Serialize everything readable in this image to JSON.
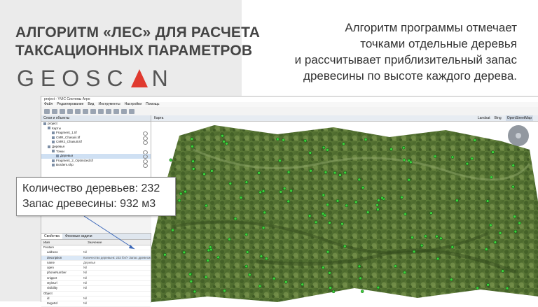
{
  "slide": {
    "title_line1": "АЛГОРИТМ «ЛЕС» ДЛЯ РАСЧЕТА",
    "title_line2": "ТАКСАЦИОННЫХ ПАРАМЕТРОВ",
    "brand_part1": "GEOSC",
    "brand_part2": "N",
    "description": [
      "Алгоритм программы отмечает",
      "точками отдельные деревья",
      "и рассчитывает приблизительный запас",
      "древесины по высоте каждого дерева."
    ],
    "accent_color": "#e03a2f"
  },
  "app": {
    "window_title": "project - YVIC Системы Агро",
    "menu": [
      "Файл",
      "Редактирование",
      "Вид",
      "Инструменты",
      "Настройки",
      "Помощь"
    ],
    "layers_tab": "Слои и объекты",
    "tree": [
      {
        "label": "project",
        "indent": 0
      },
      {
        "label": "Карты",
        "indent": 1
      },
      {
        "label": "Fragment_1.tif",
        "indent": 2
      },
      {
        "label": "CMR_Chasuiii.tif",
        "indent": 2
      },
      {
        "label": "CMR2_Chasuiii.tif",
        "indent": 2
      },
      {
        "label": "Деревья",
        "indent": 1
      },
      {
        "label": "Точки",
        "indent": 2
      },
      {
        "label": "Деревья",
        "indent": 3
      },
      {
        "label": "Fragment_2_Optimized.tif",
        "indent": 2
      },
      {
        "label": "Borders.shp",
        "indent": 2
      }
    ],
    "properties_tab": "Свойства",
    "tasks_tab": "Фоновые задачи",
    "props_header": {
      "name": "Имя",
      "value": "Значение"
    },
    "props": [
      {
        "key": "Feature",
        "value": "",
        "group": true
      },
      {
        "key": "address",
        "value": "Nil"
      },
      {
        "key": "description",
        "value": "Количество деревьев: 232 /br/> Запас древесины: 932.17 м³/br/>",
        "selected": true
      },
      {
        "key": "name",
        "value": "Деревья"
      },
      {
        "key": "open",
        "value": "Nil"
      },
      {
        "key": "phoneNumber",
        "value": "Nil"
      },
      {
        "key": "snippet",
        "value": "Nil"
      },
      {
        "key": "styleUrl",
        "value": "Nil"
      },
      {
        "key": "visibility",
        "value": "Nil"
      },
      {
        "key": "Object",
        "value": "",
        "group": true
      },
      {
        "key": "id",
        "value": "Nil"
      },
      {
        "key": "targetId",
        "value": "Nil"
      }
    ],
    "map_tab": "Карта",
    "map_sources": [
      "Landsat",
      "Bing",
      "OpenStreetMap"
    ]
  },
  "callout": {
    "line1": "Количество деревьев: 232",
    "line2": "Запас древесины: 932 м3"
  }
}
